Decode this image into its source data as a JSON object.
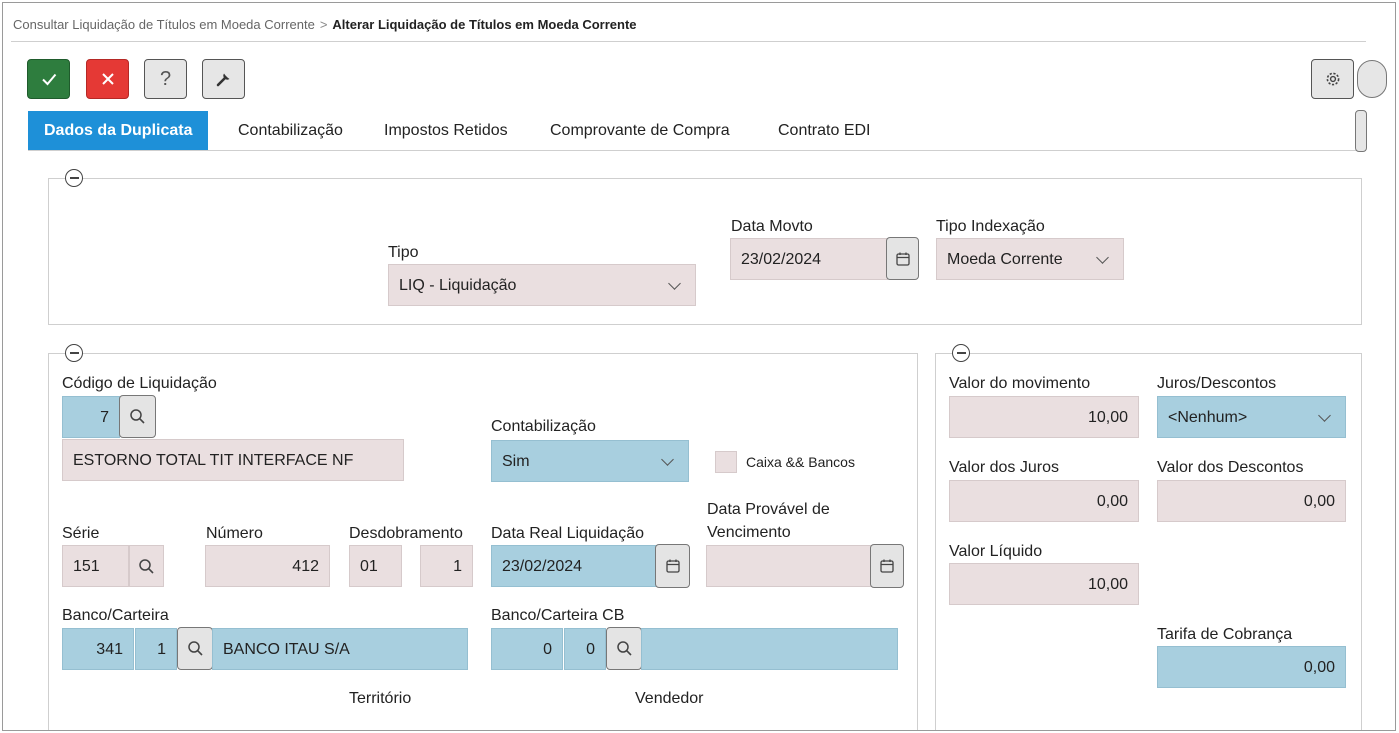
{
  "breadcrumb": {
    "parent": "Consultar Liquidação de Títulos em Moeda Corrente",
    "separator": ">",
    "current": "Alterar Liquidação de Títulos em Moeda Corrente"
  },
  "toolbar": {
    "ok_icon": "check-icon",
    "cancel_icon": "close-icon",
    "help_label": "?",
    "tools_icon": "wrench-icon",
    "settings_icon": "gear-icon"
  },
  "tabs": [
    {
      "label": "Dados da Duplicata",
      "active": true
    },
    {
      "label": "Contabilização"
    },
    {
      "label": "Impostos Retidos"
    },
    {
      "label": "Comprovante de Compra"
    },
    {
      "label": "Contrato EDI"
    }
  ],
  "top_section": {
    "tipo": {
      "label": "Tipo",
      "value": "LIQ - Liquidação"
    },
    "data_movto": {
      "label": "Data Movto",
      "value": "23/02/2024"
    },
    "tipo_indexacao": {
      "label": "Tipo Indexação",
      "value": "Moeda Corrente"
    }
  },
  "left_section": {
    "codigo_liquidacao": {
      "label": "Código de Liquidação",
      "code": "7",
      "description": "ESTORNO TOTAL TIT INTERFACE NF"
    },
    "contabilizacao": {
      "label": "Contabilização",
      "value": "Sim"
    },
    "caixa_bancos": {
      "label": "Caixa && Bancos"
    },
    "serie": {
      "label": "Série",
      "value": "151"
    },
    "numero": {
      "label": "Número",
      "value": "412"
    },
    "desdobramento": {
      "label": "Desdobramento",
      "value1": "01",
      "value2": "1"
    },
    "data_real": {
      "label": "Data Real Liquidação",
      "value": "23/02/2024"
    },
    "data_provavel": {
      "label_line1": "Data Provável de",
      "label_line2": "Vencimento",
      "value": ""
    },
    "banco_carteira": {
      "label": "Banco/Carteira",
      "banco": "341",
      "carteira": "1",
      "nome": "BANCO ITAU S/A"
    },
    "banco_carteira_cb": {
      "label": "Banco/Carteira CB",
      "banco": "0",
      "carteira": "0",
      "nome": ""
    },
    "territorio": {
      "label": "Território"
    },
    "vendedor": {
      "label": "Vendedor"
    }
  },
  "right_section": {
    "valor_movimento": {
      "label": "Valor do movimento",
      "value": "10,00"
    },
    "juros_descontos": {
      "label": "Juros/Descontos",
      "value": "<Nenhum>"
    },
    "valor_juros": {
      "label": "Valor dos Juros",
      "value": "0,00"
    },
    "valor_descontos": {
      "label": "Valor dos Descontos",
      "value": "0,00"
    },
    "valor_liquido": {
      "label": "Valor Líquido",
      "value": "10,00"
    },
    "tarifa_cobranca": {
      "label": "Tarifa de Cobrança",
      "value": "0,00"
    }
  },
  "colors": {
    "accent_tab": "#1e90d8",
    "ok_button": "#2e7d3e",
    "cancel_button": "#e53935",
    "readonly_field": "#eadfe0",
    "lookup_field": "#a8cfdf"
  }
}
